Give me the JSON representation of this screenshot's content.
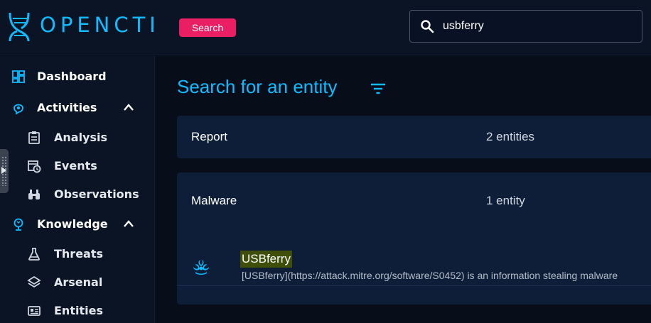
{
  "header": {
    "brand": "OPENCTI",
    "search_chip": "Search",
    "search_value": "usbferry"
  },
  "sidebar": {
    "items": [
      {
        "label": "Dashboard",
        "icon": "dashboard-icon",
        "level": "top"
      },
      {
        "label": "Activities",
        "icon": "activities-icon",
        "level": "top",
        "expanded": true
      },
      {
        "label": "Analysis",
        "icon": "analysis-icon",
        "level": "sub"
      },
      {
        "label": "Events",
        "icon": "events-icon",
        "level": "sub"
      },
      {
        "label": "Observations",
        "icon": "observations-icon",
        "level": "sub"
      },
      {
        "label": "Knowledge",
        "icon": "knowledge-icon",
        "level": "top",
        "expanded": true
      },
      {
        "label": "Threats",
        "icon": "threats-icon",
        "level": "sub"
      },
      {
        "label": "Arsenal",
        "icon": "arsenal-icon",
        "level": "sub"
      },
      {
        "label": "Entities",
        "icon": "entities-icon",
        "level": "sub"
      }
    ]
  },
  "main": {
    "title": "Search for an entity",
    "groups": [
      {
        "name": "Report",
        "count": "2 entities"
      },
      {
        "name": "Malware",
        "count": "1 entity",
        "results": [
          {
            "name": "USBferry",
            "description": "[USBferry](https://attack.mitre.org/software/S0452) is an information stealing malware"
          }
        ]
      }
    ]
  },
  "colors": {
    "accent": "#0fbcff",
    "chip": "#e91e63",
    "panel": "#0f1e38",
    "background": "#070d19",
    "highlight": "#3f4f0a"
  }
}
